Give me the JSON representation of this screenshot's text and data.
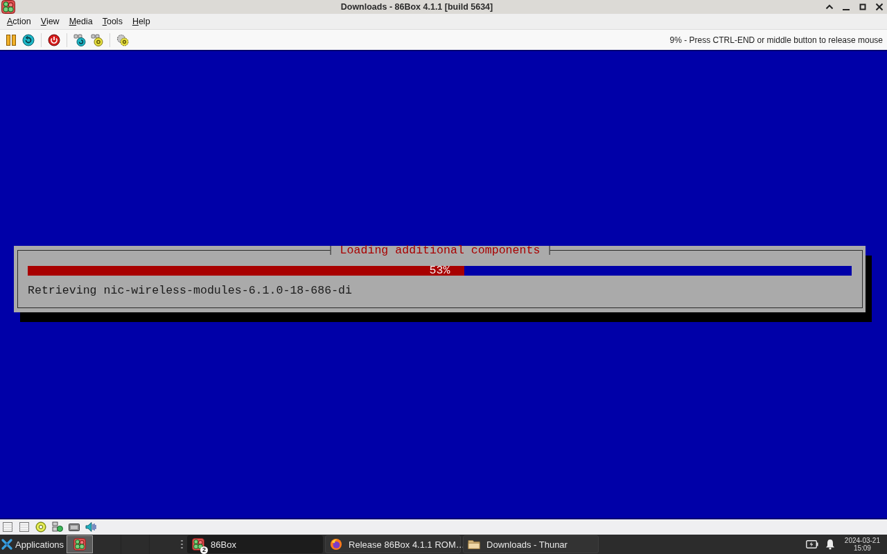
{
  "window": {
    "title": "Downloads - 86Box 4.1.1 [build 5634]"
  },
  "menu_bar": [
    "Action",
    "View",
    "Media",
    "Tools",
    "Help"
  ],
  "toolbar": {
    "status_text": "9% - Press CTRL-END or middle button to release mouse"
  },
  "screen": {
    "dialog": {
      "title": "Loading additional components",
      "progress": {
        "level": 0.53,
        "reading": "53%"
      },
      "message": "Retrieving nic-wireless-modules-6.1.0-18-686-di"
    }
  },
  "taskbar": {
    "menu_label": "Applications",
    "tasks": [
      {
        "kind": "emulator",
        "label": "86Box",
        "badge": "2",
        "selected": true
      },
      {
        "kind": "browser",
        "label": "Release 86Box 4.1.1 ROM…",
        "selected": false
      },
      {
        "kind": "folder",
        "label": "Downloads - Thunar",
        "selected": false
      }
    ],
    "clock": {
      "date": "2024-03-21",
      "time": "15:09"
    }
  }
}
